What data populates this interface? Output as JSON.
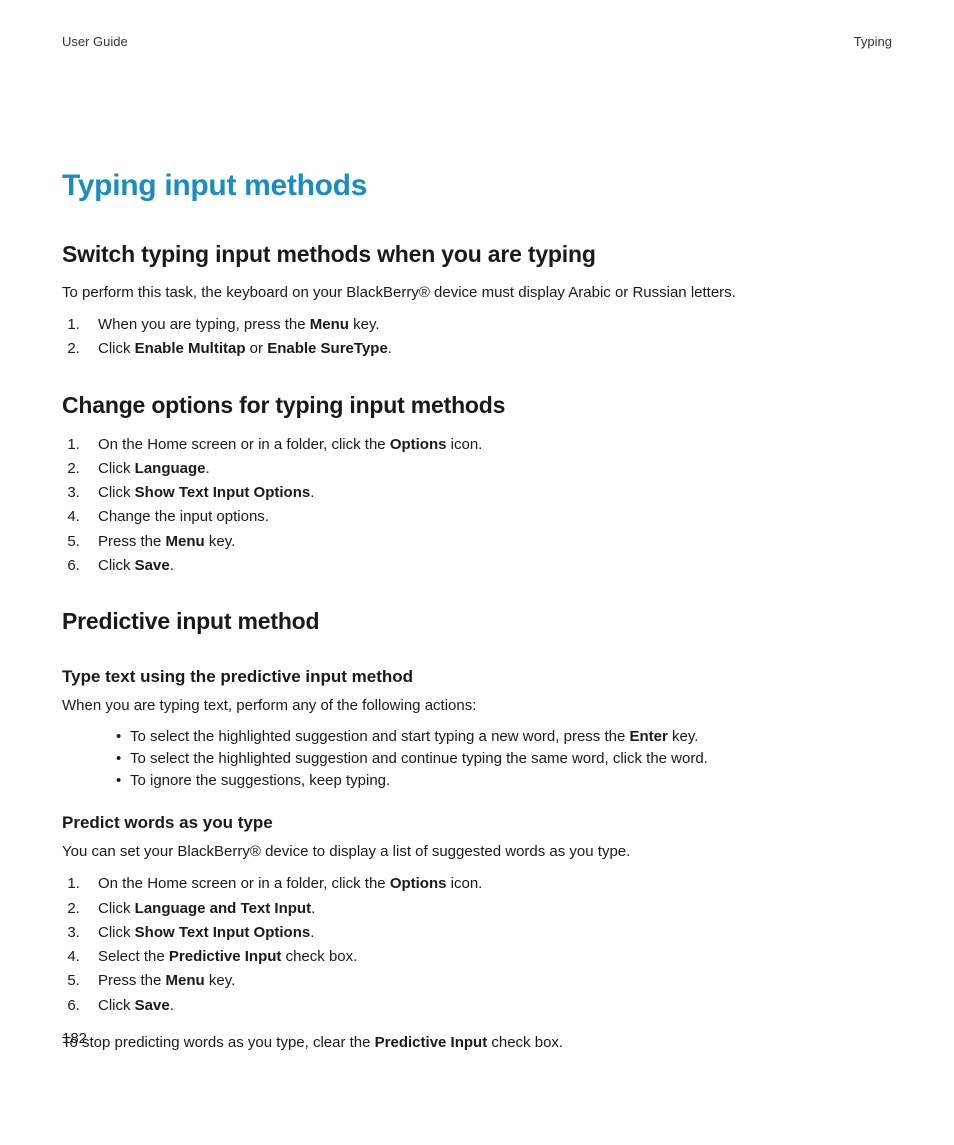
{
  "header": {
    "left": "User Guide",
    "right": "Typing"
  },
  "heading": "Typing input methods",
  "section1": {
    "heading": "Switch typing input methods when you are typing",
    "intro": "To perform this task, the keyboard on your BlackBerry® device must display Arabic or Russian letters.",
    "steps": {
      "s1a": "When you are typing, press the ",
      "s1b": "Menu",
      "s1c": " key.",
      "s2a": "Click ",
      "s2b": "Enable Multitap",
      "s2c": " or ",
      "s2d": "Enable SureType",
      "s2e": "."
    }
  },
  "section2": {
    "heading": "Change options for typing input methods",
    "steps": {
      "s1a": "On the Home screen or in a folder, click the ",
      "s1b": "Options",
      "s1c": " icon.",
      "s2a": "Click ",
      "s2b": "Language",
      "s2c": ".",
      "s3a": "Click ",
      "s3b": "Show Text Input Options",
      "s3c": ".",
      "s4": "Change the input options.",
      "s5a": "Press the ",
      "s5b": "Menu",
      "s5c": " key.",
      "s6a": "Click ",
      "s6b": "Save",
      "s6c": "."
    }
  },
  "section3": {
    "heading": "Predictive input method",
    "sub1": {
      "heading": "Type text using the predictive input method",
      "intro": "When you are typing text, perform any of the following actions:",
      "b1a": "To select the highlighted suggestion and start typing a new word, press the ",
      "b1b": "Enter",
      "b1c": " key.",
      "b2": "To select the highlighted suggestion and continue typing the same word, click the word.",
      "b3": "To ignore the suggestions, keep typing."
    },
    "sub2": {
      "heading": "Predict words as you type",
      "intro": "You can set your BlackBerry® device to display a list of suggested words as you type.",
      "steps": {
        "s1a": "On the Home screen or in a folder, click the ",
        "s1b": "Options",
        "s1c": " icon.",
        "s2a": "Click ",
        "s2b": "Language and Text Input",
        "s2c": ".",
        "s3a": "Click ",
        "s3b": "Show Text Input Options",
        "s3c": ".",
        "s4a": "Select the ",
        "s4b": "Predictive Input",
        "s4c": " check box.",
        "s5a": "Press the ",
        "s5b": "Menu",
        "s5c": " key.",
        "s6a": "Click ",
        "s6b": "Save",
        "s6c": "."
      },
      "outro_a": "To stop predicting words as you type, clear the ",
      "outro_b": "Predictive Input",
      "outro_c": " check box."
    }
  },
  "page_number": "182"
}
